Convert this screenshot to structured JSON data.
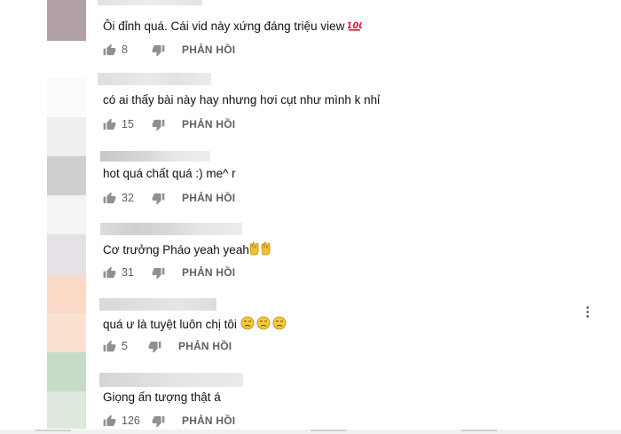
{
  "reply_label": "PHẢN HỒI",
  "more_icon": "more-vertical-icon",
  "comments": [
    {
      "text": "Ôi đỉnh quá. Cái vid này xứng đáng triệu view ",
      "emoji": "100-icon",
      "likes": "8"
    },
    {
      "text": "có ai thấy bài này hay nhưng hơi cụt như mình k nhỉ",
      "likes": "15"
    },
    {
      "text": "hot quá  chất quá :) me^ r",
      "likes": "32"
    },
    {
      "text": "Cơ trưởng Pháo yeah yeah",
      "emoji": "raised-hands-icon",
      "likes": "31"
    },
    {
      "text": "quá ư là tuyệt luôn chị tôi ",
      "emoji": "disappointed-face-icon",
      "likes": "5"
    },
    {
      "text": "Giọng ấn tượng thật á",
      "likes": "126"
    }
  ]
}
